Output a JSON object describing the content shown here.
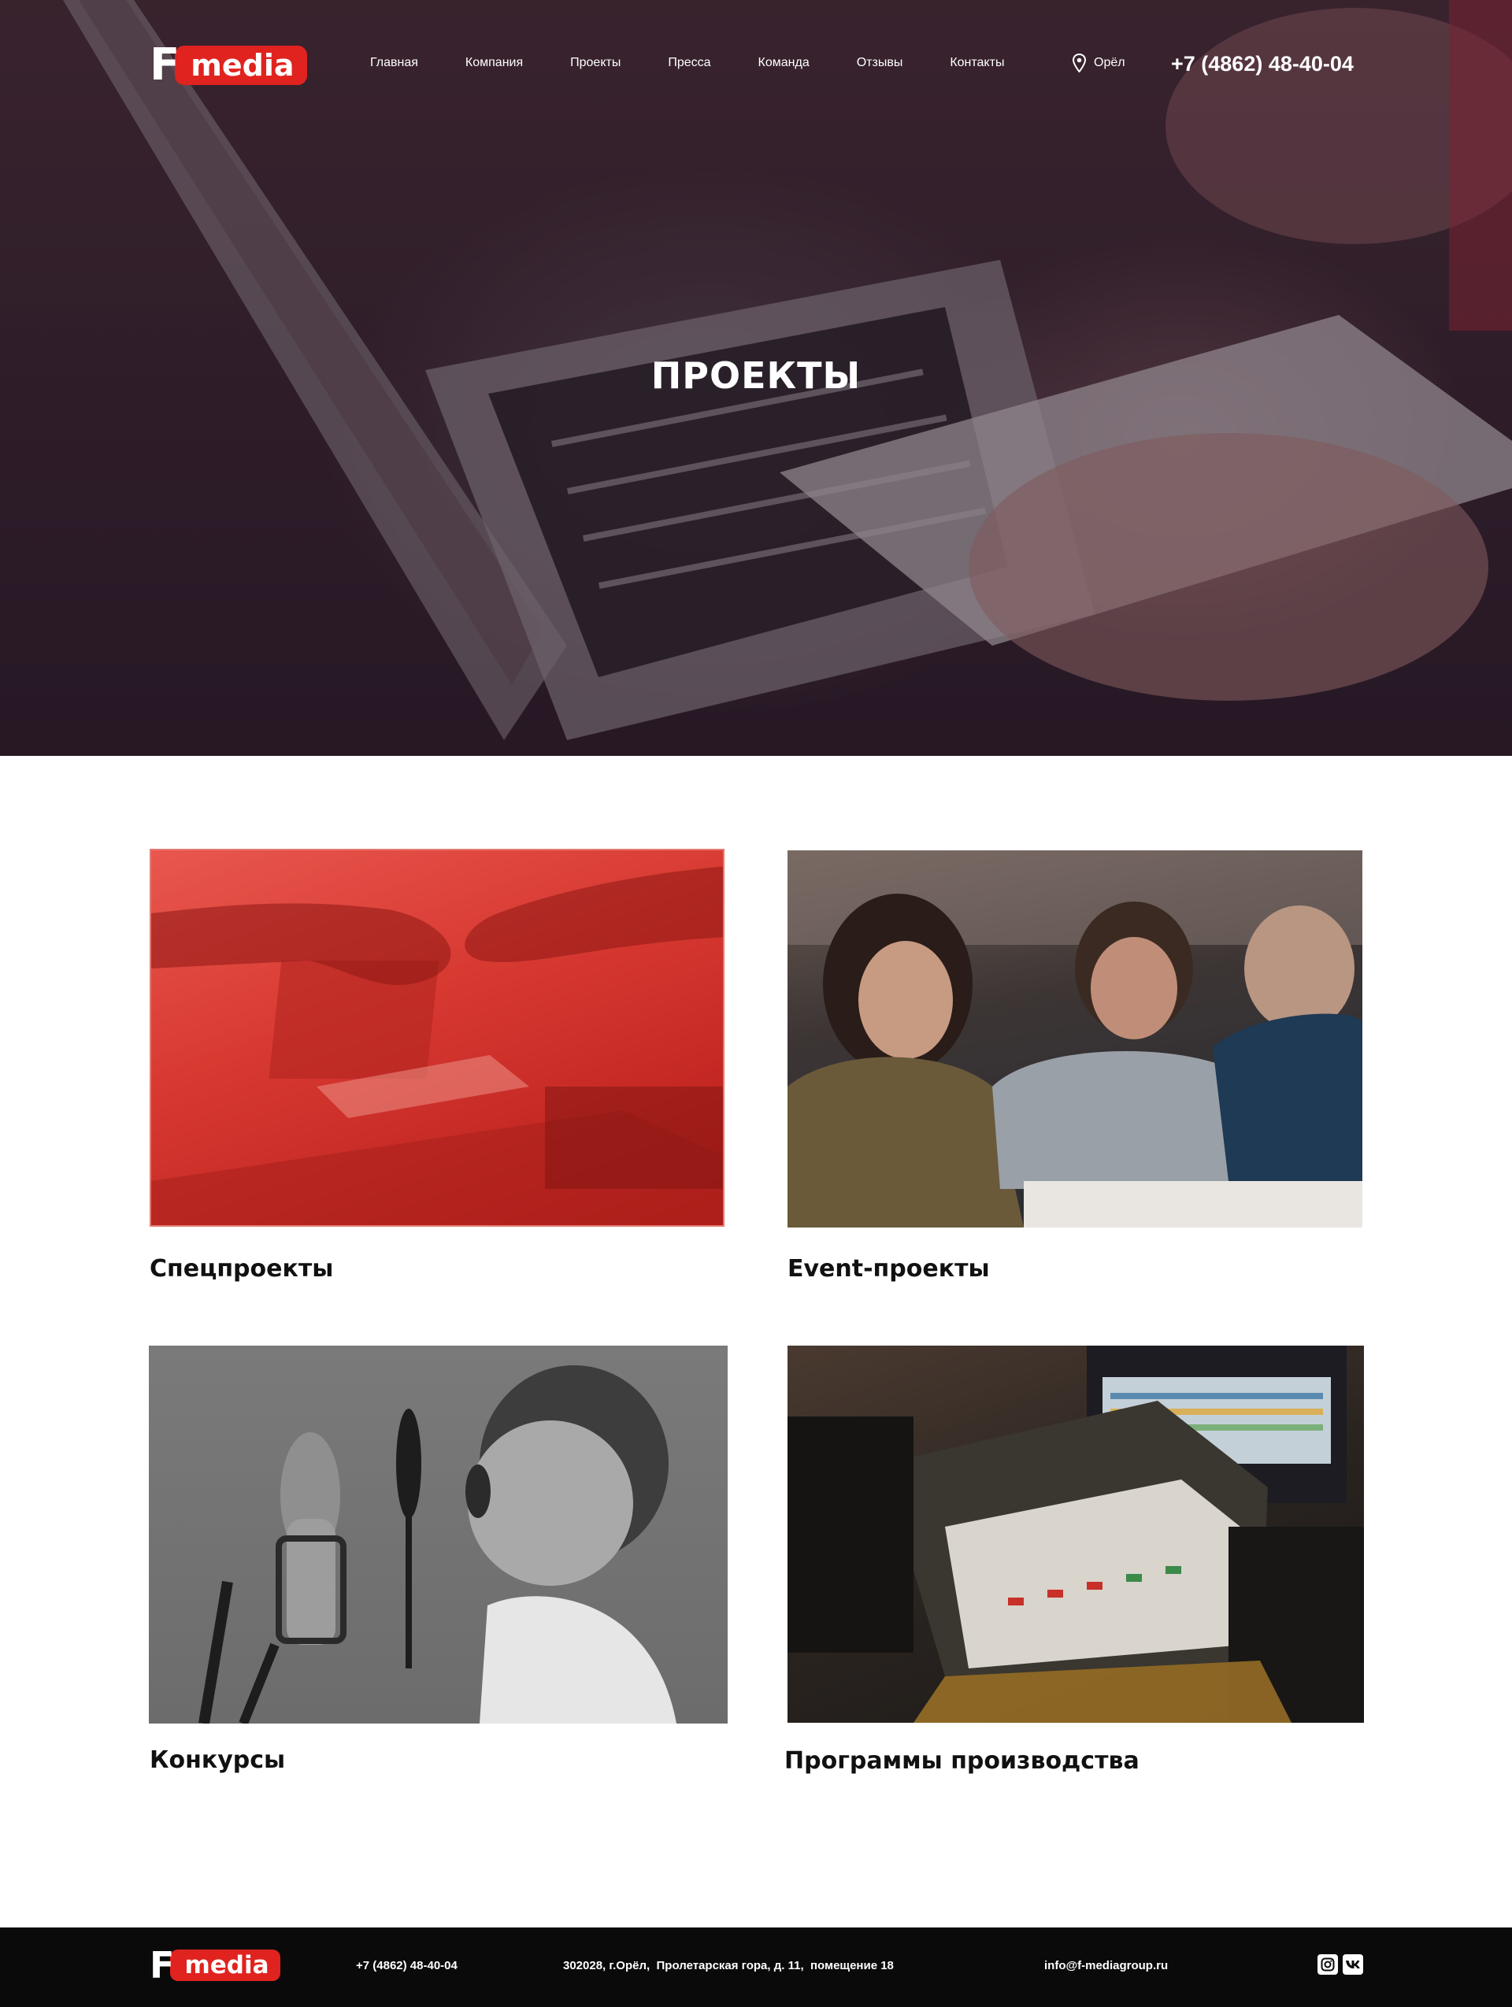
{
  "header": {
    "logo": {
      "letter": "F",
      "word": "media"
    },
    "nav": [
      "Главная",
      "Компания",
      "Проекты",
      "Пресса",
      "Команда",
      "Отзывы",
      "Контакты"
    ],
    "city": "Орёл",
    "phone": "+7 (4862) 48-40-04"
  },
  "hero": {
    "title": "ПРОЕКТЫ"
  },
  "projects": [
    {
      "title": "Спецпроекты"
    },
    {
      "title": "Event-проекты"
    },
    {
      "title": "Конкурсы"
    },
    {
      "title": "Программы производства"
    }
  ],
  "footer": {
    "logo": {
      "letter": "F",
      "word": "media"
    },
    "phone": "+7 (4862) 48-40-04",
    "address": "302028, г.Орёл,  Пролетарская гора, д. 11,  помещение 18",
    "email": "info@f-mediagroup.ru",
    "social_icons": [
      "instagram-icon",
      "vk-icon"
    ]
  },
  "colors": {
    "brand_red": "#e0231f",
    "footer_bg": "#0a0a0a"
  }
}
